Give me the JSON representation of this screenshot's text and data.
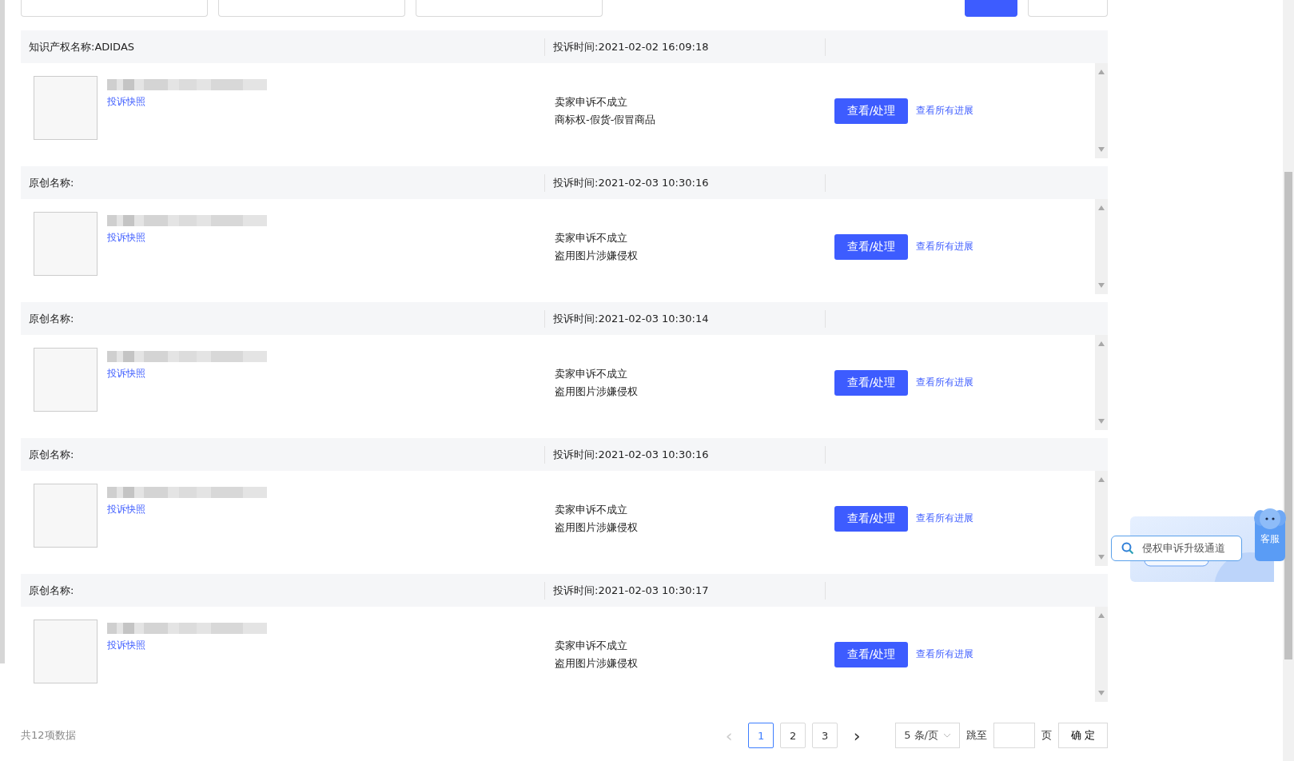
{
  "toolbar": {
    "fields": [
      {
        "kind": "field"
      },
      {
        "kind": "field"
      },
      {
        "kind": "field"
      }
    ]
  },
  "rows": [
    {
      "name_label": "知识产权名称:ADIDAS",
      "time": "投诉时间:2021-02-02 16:09:18",
      "snapshot": "投诉快照",
      "status": "卖家申诉不成立",
      "reason": "商标权-假货-假冒商品",
      "action": "查看/处理",
      "progress": "查看所有进展"
    },
    {
      "name_label": "原创名称:",
      "time": "投诉时间:2021-02-03 10:30:16",
      "snapshot": "投诉快照",
      "status": "卖家申诉不成立",
      "reason": "盗用图片涉嫌侵权",
      "action": "查看/处理",
      "progress": "查看所有进展"
    },
    {
      "name_label": "原创名称:",
      "time": "投诉时间:2021-02-03 10:30:14",
      "snapshot": "投诉快照",
      "status": "卖家申诉不成立",
      "reason": "盗用图片涉嫌侵权",
      "action": "查看/处理",
      "progress": "查看所有进展"
    },
    {
      "name_label": "原创名称:",
      "time": "投诉时间:2021-02-03 10:30:16",
      "snapshot": "投诉快照",
      "status": "卖家申诉不成立",
      "reason": "盗用图片涉嫌侵权",
      "action": "查看/处理",
      "progress": "查看所有进展"
    },
    {
      "name_label": "原创名称:",
      "time": "投诉时间:2021-02-03 10:30:17",
      "snapshot": "投诉快照",
      "status": "卖家申诉不成立",
      "reason": "盗用图片涉嫌侵权",
      "action": "查看/处理",
      "progress": "查看所有进展"
    }
  ],
  "pagination": {
    "total": "共12项数据",
    "prev": {
      "label": "‹",
      "disabled": true
    },
    "pages": [
      {
        "label": "1",
        "selected": true
      },
      {
        "label": "2",
        "selected": false
      },
      {
        "label": "3",
        "selected": false
      }
    ],
    "next": {
      "label": "›",
      "disabled": false
    },
    "page_size": "5 条/页",
    "jump_label": "跳至",
    "page_unit": "页",
    "confirm": "确 定"
  },
  "widget": {
    "search_text": "侵权申诉升级通道",
    "service": "客服"
  }
}
